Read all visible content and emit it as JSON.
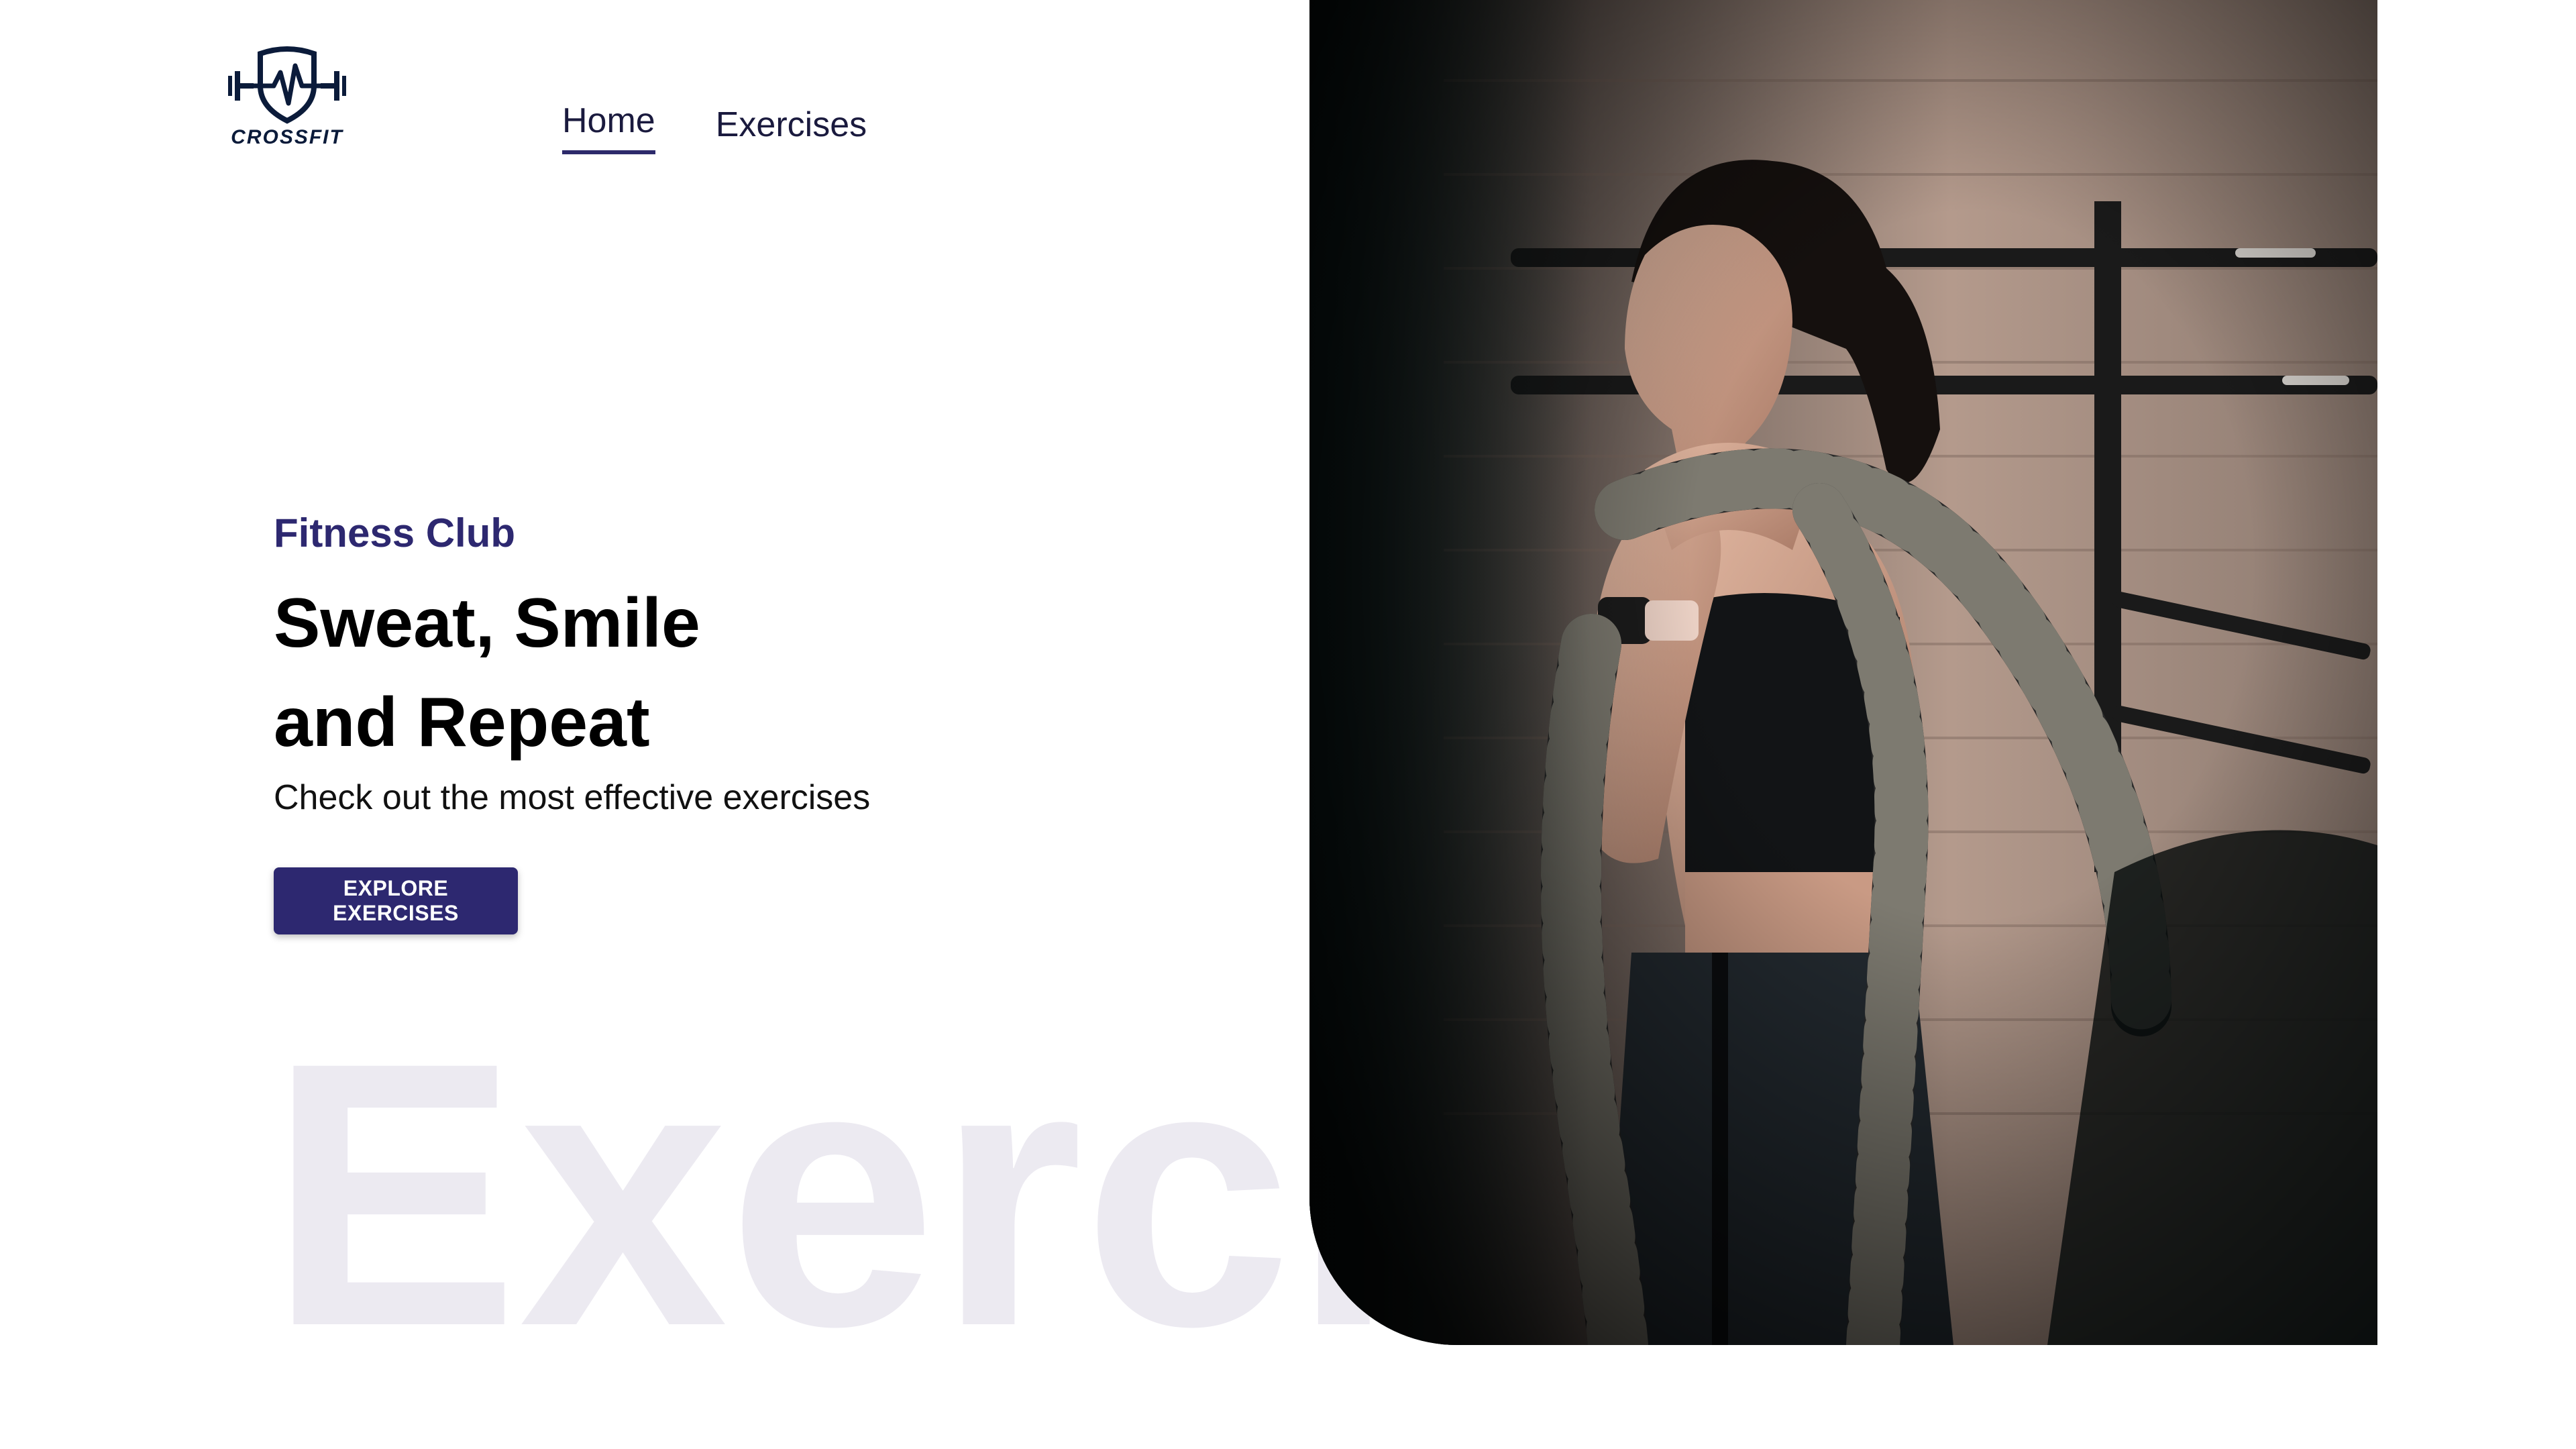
{
  "brand": {
    "logo_text": "CROSSFIT",
    "logo_icon": "shield-heartbeat-barbell-icon",
    "color": "#0b1b3a"
  },
  "nav": {
    "items": [
      {
        "label": "Home",
        "active": true
      },
      {
        "label": "Exercises",
        "active": false
      }
    ]
  },
  "hero": {
    "eyebrow": "Fitness Club",
    "headline_line1": "Sweat, Smile",
    "headline_line2": "and Repeat",
    "subtitle": "Check out the most effective exercises",
    "cta_label": "EXPLORE EXERCISES",
    "watermark": "Exercis",
    "image": "woman-with-battle-rope-photo"
  },
  "colors": {
    "accent": "#2d2870",
    "watermark": "#eceaf1",
    "text": "#000000"
  }
}
